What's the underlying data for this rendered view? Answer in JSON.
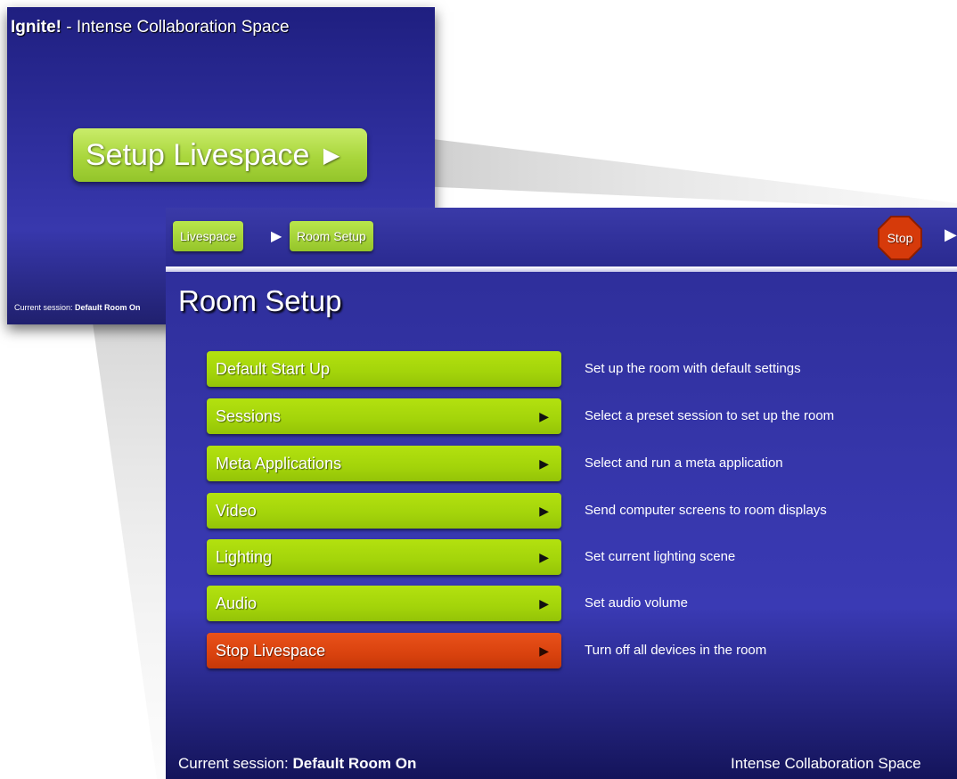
{
  "background_window": {
    "title_brand": "Ignite!",
    "title_rest": " - Intense Collaboration Space",
    "setup_button_label": "Setup Livespace",
    "session_label": "Current session: ",
    "session_value": "Default Room On"
  },
  "breadcrumb": {
    "items": [
      {
        "label": "Livespace"
      },
      {
        "label": "Room Setup"
      }
    ],
    "separator": "▶"
  },
  "toolbar": {
    "stop_label": "Stop",
    "next_arrow": "▶"
  },
  "page_title": "Room Setup",
  "menu": {
    "items": [
      {
        "label": "Default Start Up",
        "chevron": "",
        "description": "Set up the room with default settings"
      },
      {
        "label": "Sessions",
        "chevron": "▶",
        "description": "Select a preset session to set up the room"
      },
      {
        "label": "Meta Applications",
        "chevron": "▶",
        "description": "Select and run a meta application"
      },
      {
        "label": "Video",
        "chevron": "▶",
        "description": "Send computer screens to room displays"
      },
      {
        "label": "Lighting",
        "chevron": "▶",
        "description": "Set current lighting scene"
      },
      {
        "label": "Audio",
        "chevron": "▶",
        "description": "Set audio volume"
      },
      {
        "label": "Stop Livespace",
        "chevron": "▶",
        "description": "Turn off all devices in the room"
      }
    ]
  },
  "footer": {
    "session_label": "Current session: ",
    "session_value": "Default Room On",
    "space_name": "Intense Collaboration Space"
  },
  "colors": {
    "menu_green": "#a3d40a",
    "stop_red": "#d9420e",
    "window_blue": "#3535a8",
    "stop_sign": "#d63a0a"
  },
  "icons": {
    "setup_arrow": "play-arrow-icon",
    "menu_chevron": "chevron-right-icon",
    "stop_sign": "stop-sign-icon"
  }
}
